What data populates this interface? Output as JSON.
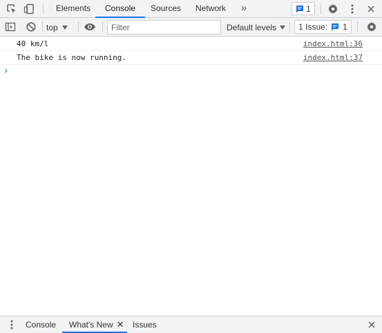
{
  "tabbar": {
    "tabs": [
      {
        "label": "Elements"
      },
      {
        "label": "Console",
        "active": true
      },
      {
        "label": "Sources"
      },
      {
        "label": "Network"
      }
    ],
    "issues_count": "1"
  },
  "toolbar": {
    "context": "top",
    "filter_placeholder": "Filter",
    "levels": "Default levels",
    "issue_label": "1 Issue:",
    "issue_count": "1"
  },
  "console": {
    "messages": [
      {
        "text": "40 km/l",
        "source": "index.html:36"
      },
      {
        "text": "The bike is now running.",
        "source": "index.html:37"
      }
    ]
  },
  "drawer": {
    "tabs": [
      {
        "label": "Console"
      },
      {
        "label": "What's New",
        "active": true
      },
      {
        "label": "Issues"
      }
    ]
  },
  "colors": {
    "accent": "#1a73e8",
    "toolbar_bg": "#f1f3f4",
    "border": "#cbcdd1"
  },
  "icons": [
    "inspect-element-icon",
    "device-toolbar-icon",
    "more-tabs-icon",
    "issues-message-icon",
    "settings-gear-icon",
    "kebab-menu-icon",
    "close-icon",
    "sidebar-toggle-icon",
    "clear-console-icon",
    "eye-icon",
    "prompt-caret-icon"
  ]
}
